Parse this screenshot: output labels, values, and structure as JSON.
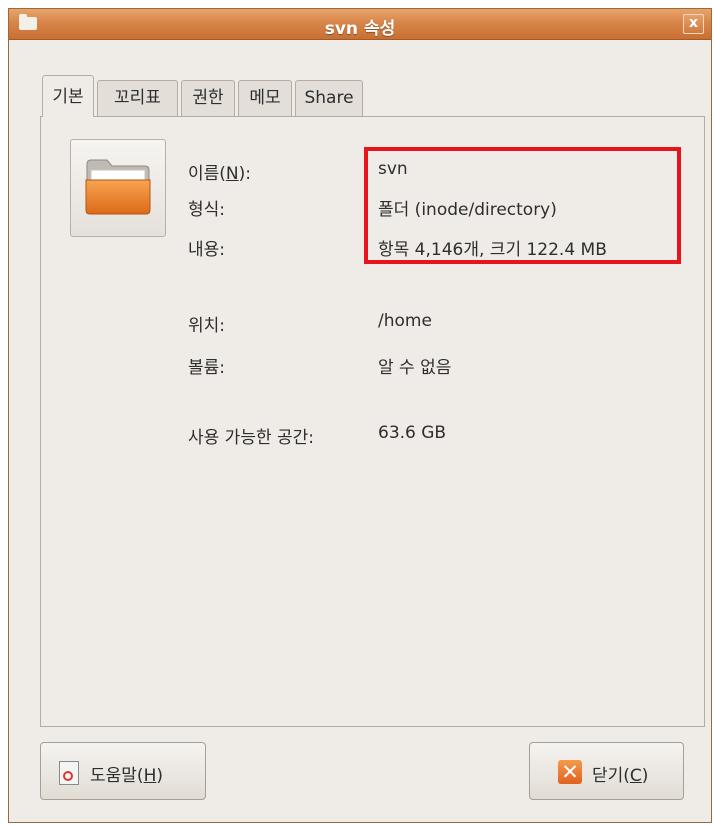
{
  "window": {
    "title": "svn 속성",
    "close_label": "x"
  },
  "tabs": [
    {
      "label": "기본",
      "active": true
    },
    {
      "label": "꼬리표",
      "active": false
    },
    {
      "label": "권한",
      "active": false
    },
    {
      "label": "메모",
      "active": false
    },
    {
      "label": "Share",
      "active": false
    }
  ],
  "basic": {
    "name_label": "이름(",
    "name_mnemonic": "N",
    "name_label_end": "):",
    "name_value": "svn",
    "type_label": "형식:",
    "type_value": "폴더 (inode/directory)",
    "contents_label": "내용:",
    "contents_value": "항목 4,146개, 크기 122.4 MB",
    "location_label": "위치:",
    "location_value": "/home",
    "volume_label": "볼륨:",
    "volume_value": "알 수 없음",
    "free_space_label": "사용 가능한 공간:",
    "free_space_value": "63.6 GB"
  },
  "buttons": {
    "help_label": "도움말(",
    "help_mnemonic": "H",
    "help_end": ")",
    "close_label": "닫기(",
    "close_mnemonic": "C",
    "close_end": ")"
  },
  "icons": {
    "folder": "folder-icon",
    "help": "help-icon",
    "close": "close-icon"
  },
  "colors": {
    "titlebar": "#d8854a",
    "highlight": "#e8141c",
    "window_bg": "#efebe7"
  }
}
